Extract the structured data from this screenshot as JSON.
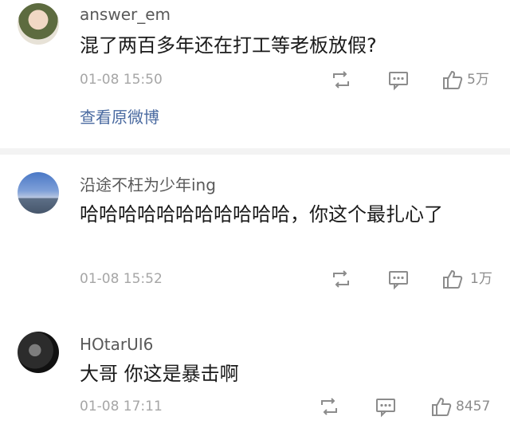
{
  "comments": [
    {
      "username": "answer_em",
      "text": "混了两百多年还在打工等老板放假?",
      "time": "01-08 15:50",
      "likes": "5万",
      "view_original": "查看原微博"
    },
    {
      "username": "沿途不枉为少年ing",
      "text": "哈哈哈哈哈哈哈哈哈哈哈，你这个最扎心了",
      "time": "01-08 15:52",
      "likes": "1万"
    },
    {
      "username": "HOtarUI6",
      "text": "大哥 你这是暴击啊",
      "time": "01-08 17:11",
      "likes": "8457"
    }
  ],
  "icons": {
    "repost": "repost-icon",
    "reply": "reply-icon",
    "like": "like-icon"
  },
  "colors": {
    "username": "#595959",
    "meta": "#a6a6a6",
    "link": "#4a6aa0",
    "divider": "#f3f3f3"
  }
}
